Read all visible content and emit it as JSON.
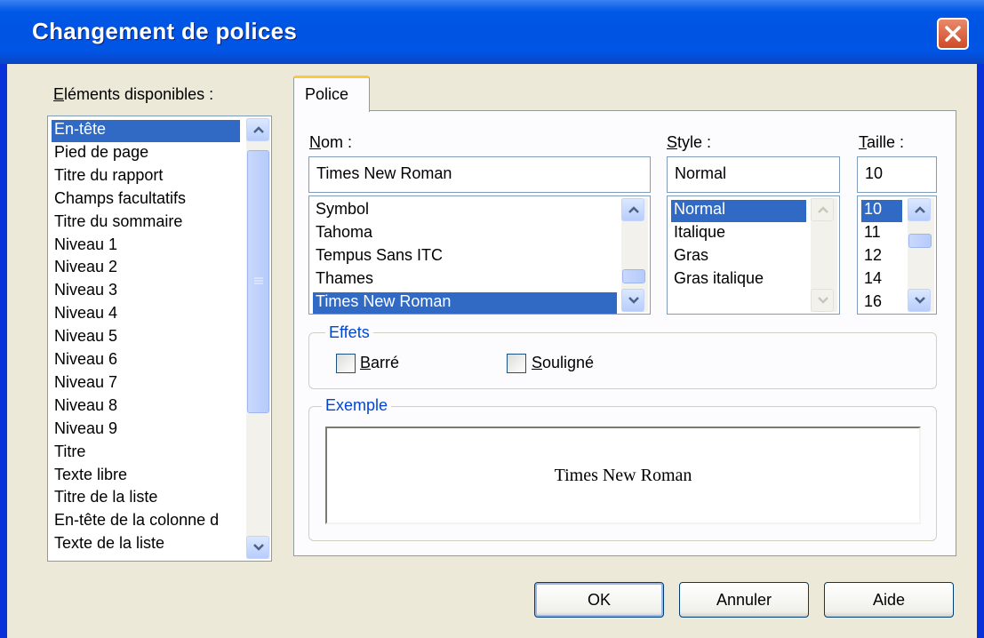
{
  "window": {
    "title": "Changement de polices"
  },
  "left": {
    "label_first": "E",
    "label_rest": "léments disponibles :",
    "items": [
      "En-tête",
      "Pied de page",
      "Titre du rapport",
      "Champs facultatifs",
      "Titre du sommaire",
      "Niveau 1",
      "Niveau 2",
      "Niveau 3",
      "Niveau 4",
      "Niveau 5",
      "Niveau 6",
      "Niveau 7",
      "Niveau 8",
      "Niveau 9",
      "Titre",
      "Texte libre",
      "Titre de la liste",
      "En-tête de la colonne d",
      "Texte de la liste"
    ],
    "selected": "En-tête"
  },
  "tab": {
    "label": "Police"
  },
  "font": {
    "label_first": "N",
    "label_rest": "om :",
    "value": "Times New Roman",
    "items": [
      "Symbol",
      "Tahoma",
      "Tempus Sans ITC",
      "Thames",
      "Times New Roman"
    ],
    "selected": "Times New Roman"
  },
  "style": {
    "label_first": "S",
    "label_rest": "tyle :",
    "value": "Normal",
    "items": [
      "Normal",
      "Italique",
      "Gras",
      "Gras italique"
    ],
    "selected": "Normal"
  },
  "size": {
    "label_first": "T",
    "label_rest": "aille :",
    "value": "10",
    "items": [
      "10",
      "11",
      "12",
      "14",
      "16"
    ],
    "selected": "10"
  },
  "effects": {
    "label": "Effets",
    "strike_first": "B",
    "strike_rest": "arré",
    "underline_first": "S",
    "underline_rest": "ouligné"
  },
  "example": {
    "label": "Exemple",
    "text": "Times New Roman"
  },
  "buttons": {
    "ok": "OK",
    "cancel": "Annuler",
    "help": "Aide"
  },
  "colors": {
    "title_bar": "#0054e3",
    "selection": "#316ac5",
    "group_label": "#0046d5",
    "dialog_bg": "#ece9d8"
  }
}
